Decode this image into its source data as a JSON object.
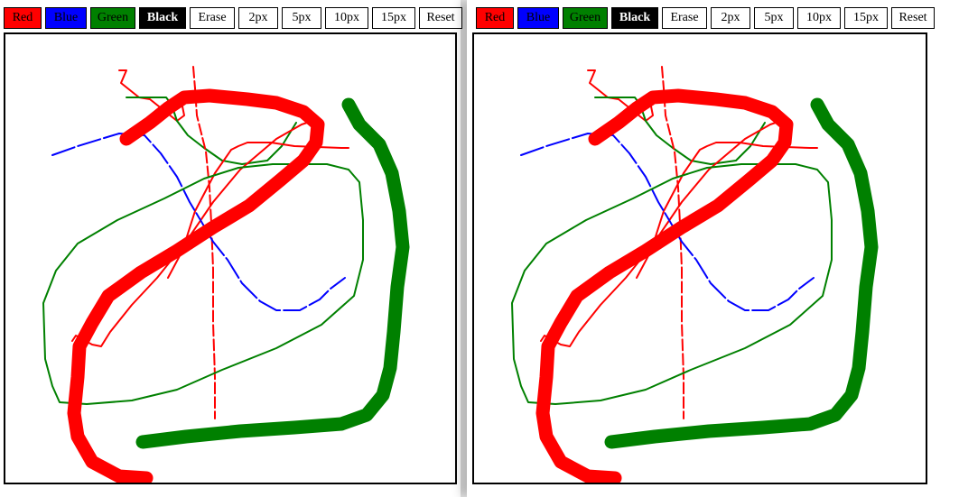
{
  "toolbar": {
    "red_label": "Red",
    "blue_label": "Blue",
    "green_label": "Green",
    "black_label": "Black",
    "erase_label": "Erase",
    "size_2_label": "2px",
    "size_5_label": "5px",
    "size_10_label": "10px",
    "size_15_label": "15px",
    "reset_label": "Reset"
  },
  "colors": {
    "red": "#ff0000",
    "blue": "#0000ff",
    "green": "#008000",
    "black": "#000000"
  }
}
